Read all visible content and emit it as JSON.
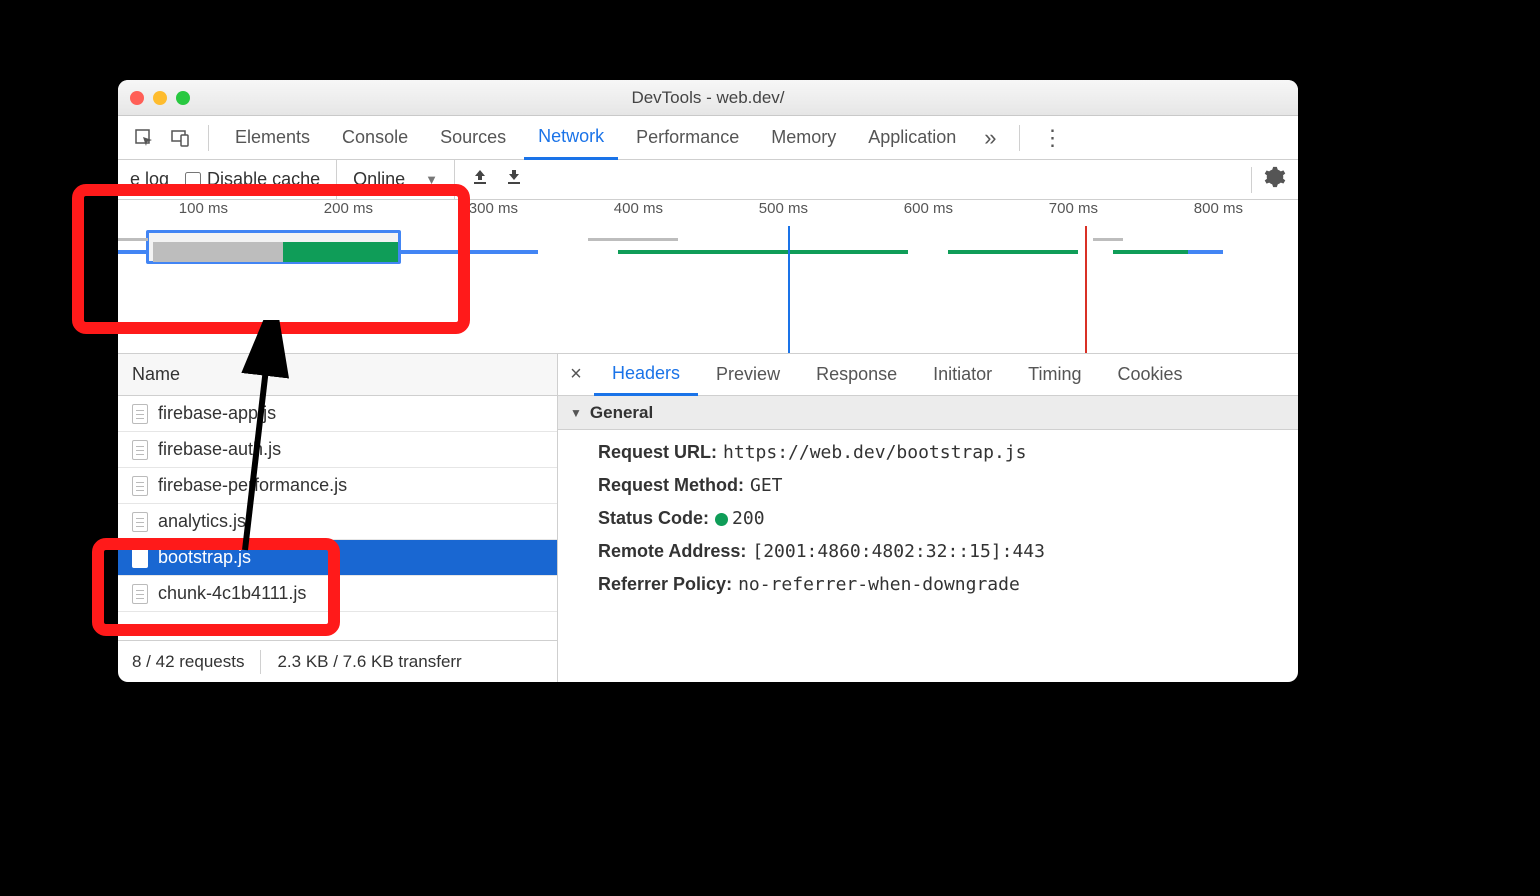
{
  "window": {
    "title": "DevTools - web.dev/"
  },
  "tabs": {
    "items": [
      "Elements",
      "Console",
      "Sources",
      "Network",
      "Performance",
      "Memory",
      "Application"
    ],
    "active": "Network",
    "overflow": "»",
    "menu": "⋮"
  },
  "controls": {
    "preserve_log_label": "e log",
    "disable_cache_label": "Disable cache",
    "throttling": "Online",
    "gear": "settings"
  },
  "timeline": {
    "ticks": [
      "100 ms",
      "200 ms",
      "300 ms",
      "400 ms",
      "500 ms",
      "600 ms",
      "700 ms",
      "800 ms"
    ]
  },
  "name_header": "Name",
  "files": [
    {
      "name": "firebase-app.js",
      "selected": false
    },
    {
      "name": "firebase-auth.js",
      "selected": false
    },
    {
      "name": "firebase-performance.js",
      "selected": false
    },
    {
      "name": "analytics.js",
      "selected": false
    },
    {
      "name": "bootstrap.js",
      "selected": true
    },
    {
      "name": "chunk-4c1b4111.js",
      "selected": false
    }
  ],
  "status": {
    "requests": "8 / 42 requests",
    "transfer": "2.3 KB / 7.6 KB transferr"
  },
  "detail_tabs": {
    "items": [
      "Headers",
      "Preview",
      "Response",
      "Initiator",
      "Timing",
      "Cookies"
    ],
    "active": "Headers",
    "close": "×"
  },
  "general": {
    "title": "General",
    "rows": [
      {
        "k": "Request URL:",
        "v": "https://web.dev/bootstrap.js",
        "mono": true
      },
      {
        "k": "Request Method:",
        "v": "GET",
        "mono": true
      },
      {
        "k": "Status Code:",
        "v": "200",
        "mono": true,
        "status": true
      },
      {
        "k": "Remote Address:",
        "v": "[2001:4860:4802:32::15]:443",
        "mono": true
      },
      {
        "k": "Referrer Policy:",
        "v": "no-referrer-when-downgrade",
        "mono": true
      }
    ]
  }
}
